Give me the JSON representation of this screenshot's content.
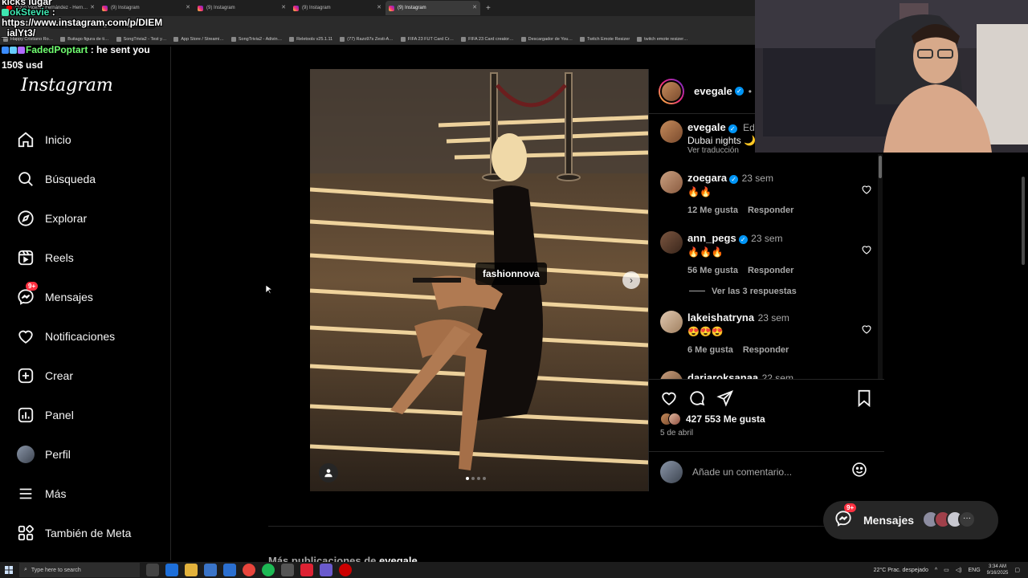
{
  "browser": {
    "tabs": [
      {
        "label": "(132) Vicente Fernández - Hern…",
        "favicon": "youtube-icon"
      },
      {
        "label": "(9) Instagram",
        "favicon": "instagram-icon"
      },
      {
        "label": "(9) Instagram",
        "favicon": "instagram-icon"
      },
      {
        "label": "(9) Instagram",
        "favicon": "instagram-icon"
      },
      {
        "label": "(9) Instagram",
        "favicon": "instagram-icon"
      }
    ],
    "url": "instagram.com/p/DIEM_ialYt3/?img_index=1",
    "bookmarks": [
      "Happy Cristiano Ro…",
      "Buitago figura de ti…",
      "SongTrivia2 - Test y…",
      "App Store / Streami…",
      "SongTrivia2 - Adivin…",
      "Reletools v25.1.11",
      "(77) Razo97s Zesti-A…",
      "FIFA 23 FUT Card Cr…",
      "FIFA 23 Card creator…",
      "Descargador de You…",
      "Twitch Emote Resizer",
      "twitch emote resizer…"
    ]
  },
  "chat_overlay": {
    "line0": "kicks lugar",
    "user1": "okStevie",
    "user1_msg": ":",
    "link": "https://www.instagram.com/p/DIEM",
    "link_cont": "_ialYt3/",
    "user2": "FadedPoptart",
    "user2_msg": ": he sent you",
    "user2_msg_cont": "150$ usd"
  },
  "sidebar": {
    "logo": "Instagram",
    "items": [
      {
        "label": "Inicio",
        "icon": "home-icon"
      },
      {
        "label": "Búsqueda",
        "icon": "search-icon"
      },
      {
        "label": "Explorar",
        "icon": "compass-icon"
      },
      {
        "label": "Reels",
        "icon": "reels-icon"
      },
      {
        "label": "Mensajes",
        "icon": "messenger-icon",
        "badge": "9+"
      },
      {
        "label": "Notificaciones",
        "icon": "heart-icon"
      },
      {
        "label": "Crear",
        "icon": "plus-square-icon"
      },
      {
        "label": "Panel",
        "icon": "dashboard-icon"
      },
      {
        "label": "Perfil",
        "icon": "profile-avatar"
      },
      {
        "label": "Más",
        "icon": "menu-icon"
      },
      {
        "label": "También de Meta",
        "icon": "meta-grid-icon"
      }
    ]
  },
  "post": {
    "author": "evegale",
    "follow_label": "Se",
    "caption_meta": "Edita",
    "caption": "Dubai nights 🌙",
    "see_translation": "Ver traducción",
    "tag": "fashionnova",
    "carousel_total": 4,
    "carousel_index": 1,
    "comments": [
      {
        "user": "zoegara",
        "verified": true,
        "time": "23 sem",
        "text": "🔥🔥",
        "likes": "12 Me gusta",
        "reply": "Responder"
      },
      {
        "user": "ann_pegs",
        "verified": true,
        "time": "23 sem",
        "text": "🔥🔥🔥",
        "likes": "56 Me gusta",
        "reply": "Responder",
        "replies": "Ver las 3 respuestas"
      },
      {
        "user": "lakeishatryna",
        "verified": false,
        "time": "23 sem",
        "text": "😍😍😍",
        "likes": "6 Me gusta",
        "reply": "Responder"
      },
      {
        "user": "dariaroksanaa",
        "verified": false,
        "time": "22 sem"
      }
    ],
    "likes": "427 553 Me gusta",
    "date": "5 de abril",
    "comment_placeholder": "Añade un comentario..."
  },
  "more_posts": {
    "prefix": "Más publicaciones de",
    "user": "evegale"
  },
  "messages_pill": {
    "label": "Mensajes",
    "badge": "9+"
  },
  "taskbar": {
    "search_placeholder": "Type here to search",
    "weather": "22°C  Prac. despejado",
    "lang": "ENG",
    "time": "3:34 AM",
    "date": "9/16/2025"
  },
  "colors": {
    "accent": "#0095f6",
    "badge": "#ff3040",
    "background": "#000000"
  }
}
